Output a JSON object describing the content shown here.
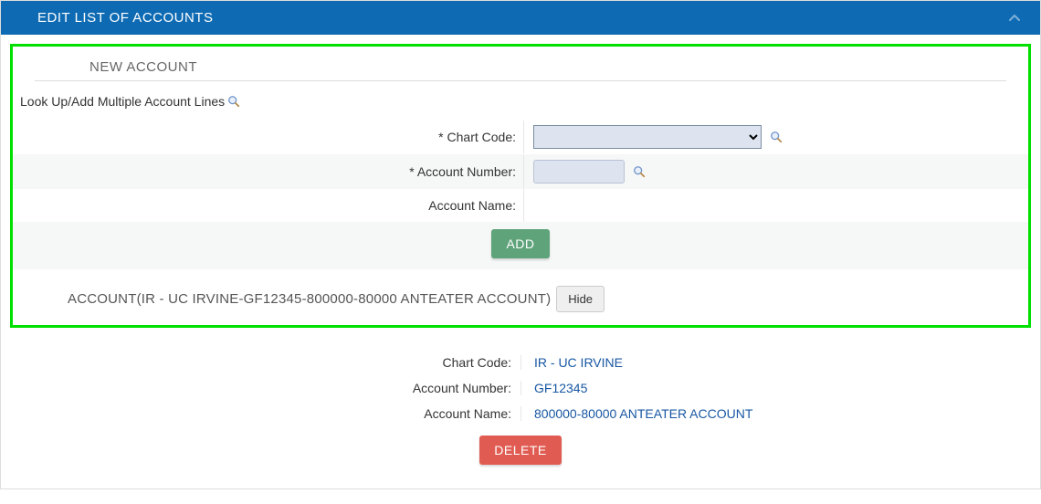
{
  "panel": {
    "title": "EDIT LIST OF ACCOUNTS"
  },
  "newAccount": {
    "section_title": "NEW ACCOUNT",
    "lookup_link": "Look Up/Add Multiple Account Lines",
    "fields": {
      "chart_code_label": "* Chart Code:",
      "chart_code_value": "",
      "account_number_label": "* Account Number:",
      "account_number_value": "",
      "account_name_label": "Account Name:"
    },
    "add_button": "ADD"
  },
  "existingAccount": {
    "header": "ACCOUNT(IR - UC IRVINE-GF12345-800000-80000 ANTEATER ACCOUNT)",
    "hide_button": "Hide",
    "details": {
      "chart_code_label": "Chart Code:",
      "chart_code_value": "IR - UC IRVINE",
      "account_number_label": "Account Number:",
      "account_number_value": "GF12345",
      "account_name_label": "Account Name:",
      "account_name_value": "800000-80000 ANTEATER ACCOUNT"
    },
    "delete_button": "DELETE"
  }
}
